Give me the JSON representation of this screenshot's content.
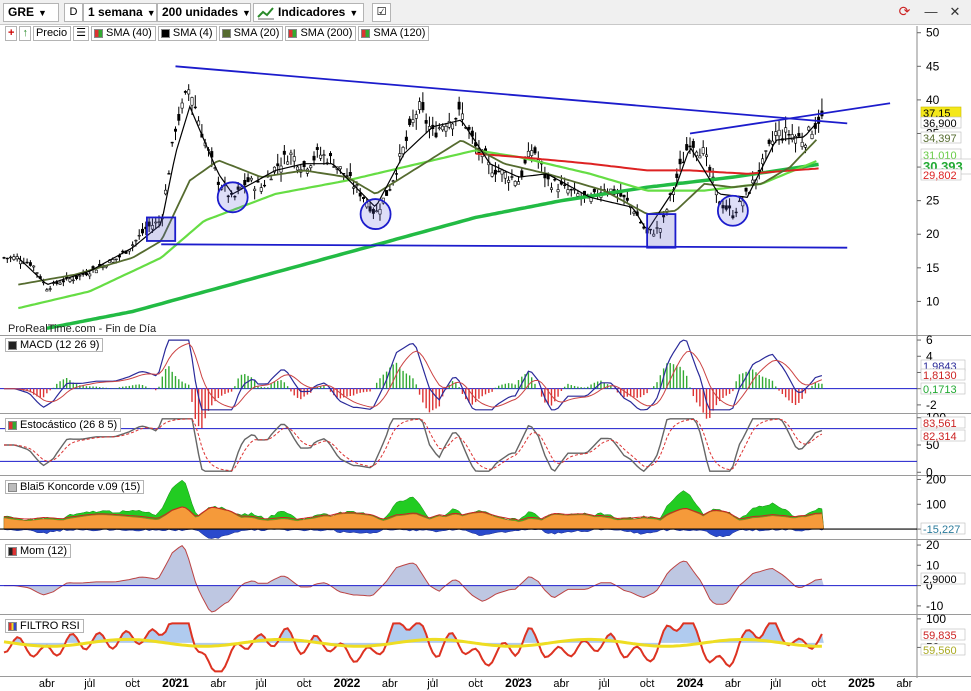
{
  "toolbar": {
    "ticker": "GRE",
    "d_button": "D",
    "timeframe": "1 semana",
    "units": "200 unidades",
    "indicators_label": "Indicadores"
  },
  "main_legend": [
    {
      "label": "Precio",
      "color": "#000000"
    },
    {
      "label": "SMA (40)",
      "color": "#2e8b2e"
    },
    {
      "label": "SMA (4)",
      "color": "#000000"
    },
    {
      "label": "SMA (20)",
      "color": "#556b2f"
    },
    {
      "label": "SMA (200)",
      "color": "#22cc44"
    },
    {
      "label": "SMA (120)",
      "color": "#dd2222"
    }
  ],
  "credit": "ProRealTime.com - Fin de Día",
  "panels": {
    "macd": {
      "label": "MACD (12 26 9)"
    },
    "stoch": {
      "label": "Estocástico (26 8 5)"
    },
    "koncorde": {
      "label": "Blai5 Koncorde v.09 (15)"
    },
    "mom": {
      "label": "Mom (12)"
    },
    "rsi": {
      "label": "FILTRO RSI"
    }
  },
  "colors": {
    "trendline": "#1c1ccc",
    "sma4": "#000000",
    "sma20": "#556b2f",
    "sma40": "#66dd44",
    "sma120": "#dd2222",
    "sma200": "#22bb44"
  },
  "chart_data": [
    {
      "type": "candlestick",
      "panel": "price",
      "ylim": [
        5,
        51
      ],
      "yticks": [
        10,
        15,
        20,
        25,
        30,
        35,
        40,
        45,
        50
      ],
      "x_ticks": [
        "abr",
        "jul",
        "oct",
        "2021",
        "abr",
        "jul",
        "oct",
        "2022",
        "abr",
        "jul",
        "oct",
        "2023",
        "abr",
        "jul",
        "oct",
        "2024",
        "abr",
        "jul",
        "oct",
        "2025",
        "abr"
      ],
      "price_keypoints": [
        [
          "2020-02",
          16.5
        ],
        [
          "2020-03",
          15.5
        ],
        [
          "2020-04",
          12
        ],
        [
          "2020-05",
          13
        ],
        [
          "2020-06",
          13.5
        ],
        [
          "2020-07",
          14.5
        ],
        [
          "2020-08",
          15.5
        ],
        [
          "2020-09",
          16.5
        ],
        [
          "2020-10",
          18.5
        ],
        [
          "2020-11",
          21
        ],
        [
          "2020-12",
          22
        ],
        [
          "2021-01",
          36
        ],
        [
          "2021-02",
          42
        ],
        [
          "2021-03",
          34
        ],
        [
          "2021-04",
          28
        ],
        [
          "2021-05",
          25
        ],
        [
          "2021-06",
          28
        ],
        [
          "2021-07",
          27
        ],
        [
          "2021-08",
          30
        ],
        [
          "2021-09",
          32
        ],
        [
          "2021-10",
          30
        ],
        [
          "2021-11",
          32
        ],
        [
          "2021-12",
          31
        ],
        [
          "2022-02",
          26
        ],
        [
          "2022-03",
          23
        ],
        [
          "2022-04",
          27
        ],
        [
          "2022-05",
          33
        ],
        [
          "2022-06",
          39
        ],
        [
          "2022-07",
          35
        ],
        [
          "2022-08",
          37
        ],
        [
          "2022-09",
          38
        ],
        [
          "2022-10",
          33
        ],
        [
          "2022-11",
          30
        ],
        [
          "2022-12",
          29
        ],
        [
          "2023-01",
          28
        ],
        [
          "2023-02",
          33
        ],
        [
          "2023-03",
          28
        ],
        [
          "2023-04",
          27
        ],
        [
          "2023-05",
          26
        ],
        [
          "2023-06",
          25
        ],
        [
          "2023-07",
          27
        ],
        [
          "2023-08",
          26
        ],
        [
          "2023-09",
          24
        ],
        [
          "2023-10",
          20
        ],
        [
          "2023-11",
          21
        ],
        [
          "2023-12",
          28
        ],
        [
          "2024-01",
          34
        ],
        [
          "2024-02",
          32
        ],
        [
          "2024-03",
          25
        ],
        [
          "2024-04",
          23
        ],
        [
          "2024-05",
          26
        ],
        [
          "2024-06",
          30
        ],
        [
          "2024-07",
          35
        ],
        [
          "2024-08",
          35
        ],
        [
          "2024-09",
          34
        ],
        [
          "2024-10",
          37.15
        ]
      ],
      "sma4_keypoints": [
        [
          "2020-02",
          16.5
        ],
        [
          "2020-04",
          12.5
        ],
        [
          "2020-07",
          14.5
        ],
        [
          "2020-10",
          18
        ],
        [
          "2020-12",
          21.5
        ],
        [
          "2021-01",
          32
        ],
        [
          "2021-02",
          39
        ],
        [
          "2021-04",
          29
        ],
        [
          "2021-05",
          26
        ],
        [
          "2021-08",
          29.5
        ],
        [
          "2021-10",
          30.5
        ],
        [
          "2021-12",
          30.5
        ],
        [
          "2022-03",
          24
        ],
        [
          "2022-05",
          32
        ],
        [
          "2022-07",
          36
        ],
        [
          "2022-09",
          37
        ],
        [
          "2022-11",
          30.5
        ],
        [
          "2023-01",
          28.5
        ],
        [
          "2023-03",
          29
        ],
        [
          "2023-06",
          25.5
        ],
        [
          "2023-09",
          24
        ],
        [
          "2023-10",
          20.5
        ],
        [
          "2023-12",
          27
        ],
        [
          "2024-01",
          33
        ],
        [
          "2024-03",
          26
        ],
        [
          "2024-05",
          25.5
        ],
        [
          "2024-07",
          34
        ],
        [
          "2024-09",
          34.5
        ],
        [
          "2024-10",
          36.9
        ]
      ],
      "sma20_keypoints": [
        [
          "2020-02",
          12.5
        ],
        [
          "2020-06",
          14
        ],
        [
          "2020-10",
          16.5
        ],
        [
          "2020-12",
          19
        ],
        [
          "2021-02",
          28
        ],
        [
          "2021-04",
          31
        ],
        [
          "2021-07",
          28.5
        ],
        [
          "2021-10",
          29.5
        ],
        [
          "2022-01",
          28.5
        ],
        [
          "2022-03",
          26
        ],
        [
          "2022-06",
          30
        ],
        [
          "2022-09",
          34
        ],
        [
          "2022-12",
          30.5
        ],
        [
          "2023-03",
          29
        ],
        [
          "2023-07",
          26.5
        ],
        [
          "2023-10",
          23
        ],
        [
          "2023-12",
          23.5
        ],
        [
          "2024-02",
          27.5
        ],
        [
          "2024-04",
          27
        ],
        [
          "2024-06",
          27.5
        ],
        [
          "2024-08",
          30
        ],
        [
          "2024-10",
          34.397
        ]
      ],
      "sma40_keypoints": [
        [
          "2020-02",
          9
        ],
        [
          "2020-07",
          11.5
        ],
        [
          "2020-12",
          16.5
        ],
        [
          "2021-03",
          22
        ],
        [
          "2021-08",
          26
        ],
        [
          "2022-01",
          28
        ],
        [
          "2022-06",
          30.5
        ],
        [
          "2022-10",
          32.5
        ],
        [
          "2023-01",
          31.5
        ],
        [
          "2023-06",
          29
        ],
        [
          "2023-10",
          26.5
        ],
        [
          "2024-02",
          26.5
        ],
        [
          "2024-06",
          27.5
        ],
        [
          "2024-10",
          31.01
        ]
      ],
      "sma120_keypoints": [
        [
          "2022-10",
          32
        ],
        [
          "2023-01",
          31.5
        ],
        [
          "2023-06",
          30.5
        ],
        [
          "2023-10",
          29.5
        ],
        [
          "2024-01",
          29.5
        ],
        [
          "2024-05",
          29
        ],
        [
          "2024-10",
          29.8
        ]
      ],
      "sma200_keypoints": [
        [
          "2020-04",
          6
        ],
        [
          "2020-10",
          8.5
        ],
        [
          "2021-04",
          12
        ],
        [
          "2021-10",
          15.5
        ],
        [
          "2022-04",
          19
        ],
        [
          "2022-10",
          22.5
        ],
        [
          "2023-04",
          25
        ],
        [
          "2023-10",
          27
        ],
        [
          "2024-04",
          28.5
        ],
        [
          "2024-10",
          30.393
        ]
      ],
      "trendlines": [
        {
          "from": [
            "2021-01",
            45
          ],
          "to": [
            "2024-12",
            36.5
          ]
        },
        {
          "from": [
            "2020-12",
            18.5
          ],
          "to": [
            "2024-12",
            18
          ]
        },
        {
          "from": [
            "2024-01",
            35
          ],
          "to": [
            "2025-03",
            39.5
          ]
        }
      ],
      "boxes": [
        {
          "from": [
            "2020-11",
            22.5
          ],
          "to": [
            "2020-12",
            19
          ]
        },
        {
          "from": [
            "2023-10",
            23
          ],
          "to": [
            "2023-11",
            18
          ]
        }
      ],
      "circles": [
        [
          "2021-05",
          25.5
        ],
        [
          "2022-03",
          23
        ],
        [
          "2024-04",
          23.5
        ]
      ],
      "price_labels": [
        {
          "value": "37,15",
          "y": 37.15,
          "bg": "#f4e81a",
          "color": "#000"
        },
        {
          "value": "36,900",
          "y": 36.9,
          "bg": "#ffffff",
          "color": "#000"
        },
        {
          "value": "34,397",
          "y": 34.397,
          "bg": "#ffffff",
          "color": "#556b2f"
        },
        {
          "value": "31,010",
          "y": 31.01,
          "bg": "#ffffff",
          "color": "#66cc44"
        },
        {
          "value": "30,393",
          "y": 30.393,
          "bg": "#ffffff",
          "color": "#22aa33"
        },
        {
          "value": "29,802",
          "y": 29.802,
          "bg": "#ffffff",
          "color": "#dd2222"
        }
      ]
    },
    {
      "type": "line",
      "panel": "macd",
      "ylim": [
        -3,
        6.5
      ],
      "yticks": [
        6,
        4,
        2,
        0,
        -2
      ],
      "labels": [
        {
          "value": "1,9843",
          "y": 1.9843
        },
        {
          "value": "1,8130",
          "y": 1.813
        },
        {
          "value": "0,1713",
          "y": 0.1713
        }
      ]
    },
    {
      "type": "line",
      "panel": "stoch",
      "ylim": [
        -5,
        105
      ],
      "yticks": [
        100,
        50,
        0
      ],
      "labels": [
        {
          "value": "83,561",
          "y": 83.561
        },
        {
          "value": "82,314",
          "y": 82.314
        }
      ]
    },
    {
      "type": "area",
      "panel": "koncorde",
      "ylim": [
        -40,
        210
      ],
      "yticks": [
        200,
        100,
        0
      ],
      "labels": [
        {
          "value": "-15,227",
          "y": -15.227
        }
      ]
    },
    {
      "type": "area",
      "panel": "mom",
      "ylim": [
        -14,
        22
      ],
      "yticks": [
        20,
        10,
        0,
        -10
      ],
      "labels": [
        {
          "value": "2,9000",
          "y": 2.9
        }
      ]
    },
    {
      "type": "area",
      "panel": "rsi",
      "ylim": [
        0,
        105
      ],
      "yticks": [
        100,
        50
      ],
      "labels": [
        {
          "value": "59,835",
          "y": 59.835
        },
        {
          "value": "59,560",
          "y": 59.56
        }
      ]
    }
  ]
}
